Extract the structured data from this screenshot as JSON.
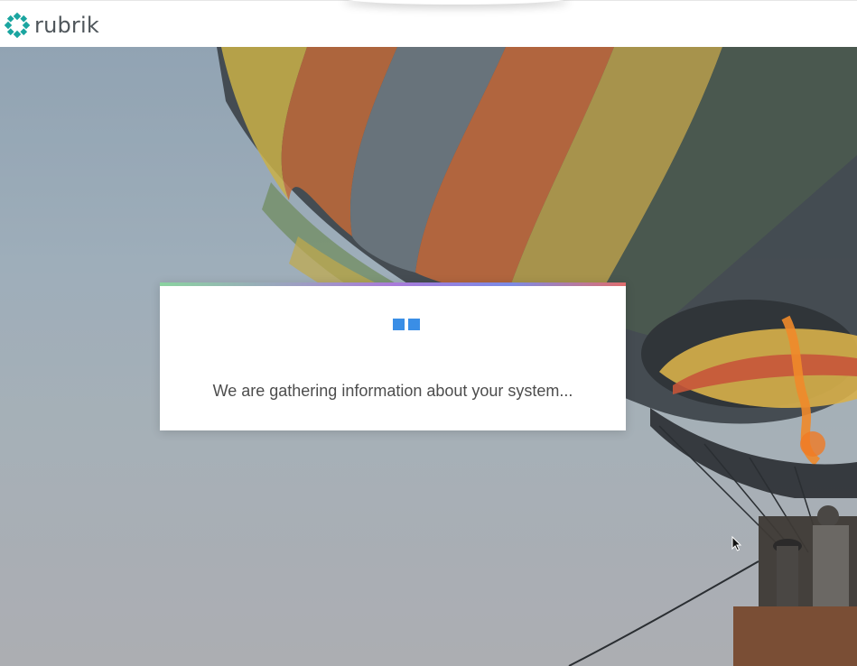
{
  "header": {
    "logo_text": "rubrik",
    "logo_icon": "rubrik-logo-icon"
  },
  "background": {
    "description_icon": "hot-air-balloon-photo"
  },
  "loading_dialog": {
    "message": "We are gathering information about your system...",
    "spinner_icon": "loading-squares-icon",
    "spinner_color": "#3a8ee6"
  },
  "colors": {
    "brand_teal": "#1aa5a0",
    "text_gray": "#4f565b"
  }
}
